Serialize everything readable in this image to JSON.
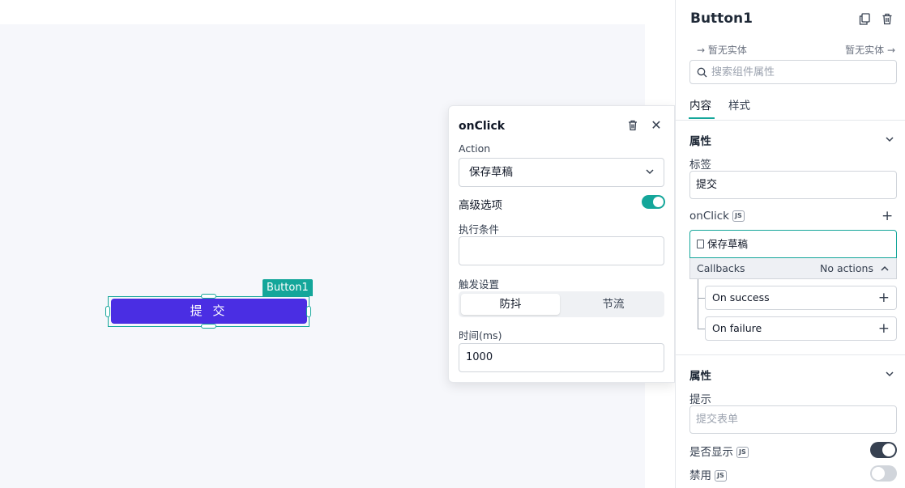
{
  "canvas": {
    "widget_tag": "Button1",
    "button_label": "提 交"
  },
  "popover": {
    "title": "onClick",
    "action_label": "Action",
    "action_value": "保存草稿",
    "advanced_label": "高级选项",
    "advanced_enabled": true,
    "condition_label": "执行条件",
    "condition_value": "",
    "trigger_label": "触发设置",
    "trigger_options": [
      "防抖",
      "节流"
    ],
    "trigger_selected": "防抖",
    "time_label": "时间(ms)",
    "time_value": "1000"
  },
  "panel": {
    "title": "Button1",
    "entity_left": "暂无实体",
    "entity_right": "暂无实体",
    "search_placeholder": "搜索组件属性",
    "tabs": [
      "内容",
      "样式"
    ],
    "active_tab": "内容",
    "section1": {
      "title": "属性",
      "label_field": {
        "label": "标签",
        "value": "提交"
      },
      "onclick_label": "onClick",
      "js_badge": "JS",
      "action_value": "保存草稿",
      "callbacks_label": "Callbacks",
      "callbacks_status": "No actions",
      "callback_items": [
        "On success",
        "On failure"
      ]
    },
    "section2": {
      "title": "属性",
      "tooltip_label": "提示",
      "tooltip_placeholder": "提交表单",
      "visible_label": "是否显示",
      "visible_on": true,
      "disabled_label": "禁用",
      "disabled_on": false
    }
  },
  "colors": {
    "accent": "#14a69a",
    "button": "#4a2ee3"
  }
}
